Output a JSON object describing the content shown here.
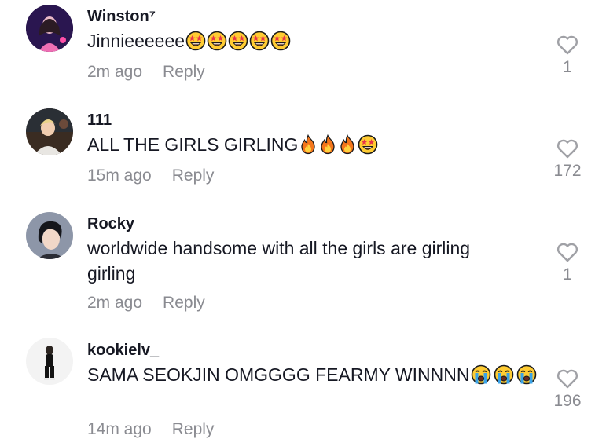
{
  "comments": [
    {
      "username": "Winston⁷",
      "text": "Jinnieeeeee",
      "emojis": [
        "star-struck",
        "star-struck",
        "star-struck",
        "star-struck",
        "star-struck"
      ],
      "time": "2m ago",
      "reply": "Reply",
      "likes": "1",
      "avatar": "avatar-winston"
    },
    {
      "username": "111",
      "text": "ALL THE GIRLS GIRLING",
      "emojis": [
        "fire",
        "fire",
        "fire",
        "star-struck"
      ],
      "time": "15m ago",
      "reply": "Reply",
      "likes": "172",
      "avatar": "avatar-111"
    },
    {
      "username": "Rocky",
      "text": "worldwide handsome with all the girls are girling girling",
      "emojis": [],
      "time": "2m ago",
      "reply": "Reply",
      "likes": "1",
      "avatar": "avatar-rocky"
    },
    {
      "username": "kookielv_",
      "text": "SAMA SEOKJIN OMGGGG FEARMY WINNNN",
      "emojis": [
        "loudly-crying",
        "loudly-crying",
        "loudly-crying"
      ],
      "time": "14m ago",
      "reply": "Reply",
      "likes": "196",
      "avatar": "avatar-kookielv"
    }
  ],
  "colors": {
    "text": "#161823",
    "muted": "#8a8b91",
    "like_outline": "#a0a1a6"
  }
}
